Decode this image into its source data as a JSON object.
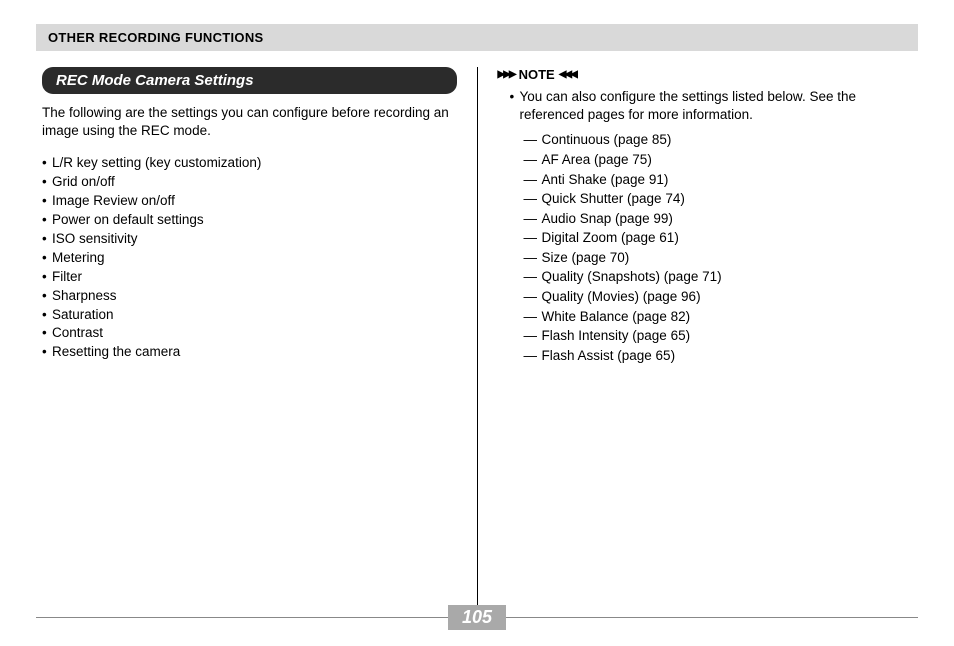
{
  "header": "OTHER RECORDING FUNCTIONS",
  "section_title": "REC Mode Camera Settings",
  "intro": "The following are the settings you can configure before recording an image using the REC mode.",
  "settings": [
    "L/R key setting (key customization)",
    "Grid on/off",
    "Image Review on/off",
    "Power on default settings",
    "ISO sensitivity",
    "Metering",
    "Filter",
    "Sharpness",
    "Saturation",
    "Contrast",
    "Resetting the camera"
  ],
  "note_label": "NOTE",
  "note_text": "You can also configure the settings listed below. See the referenced pages for more information.",
  "note_items": [
    "Continuous (page 85)",
    "AF Area (page 75)",
    "Anti Shake (page 91)",
    "Quick Shutter (page 74)",
    "Audio Snap (page 99)",
    "Digital Zoom (page 61)",
    "Size (page 70)",
    "Quality (Snapshots) (page 71)",
    "Quality (Movies) (page 96)",
    "White Balance (page 82)",
    "Flash Intensity (page 65)",
    "Flash Assist (page 65)"
  ],
  "page_number": "105"
}
